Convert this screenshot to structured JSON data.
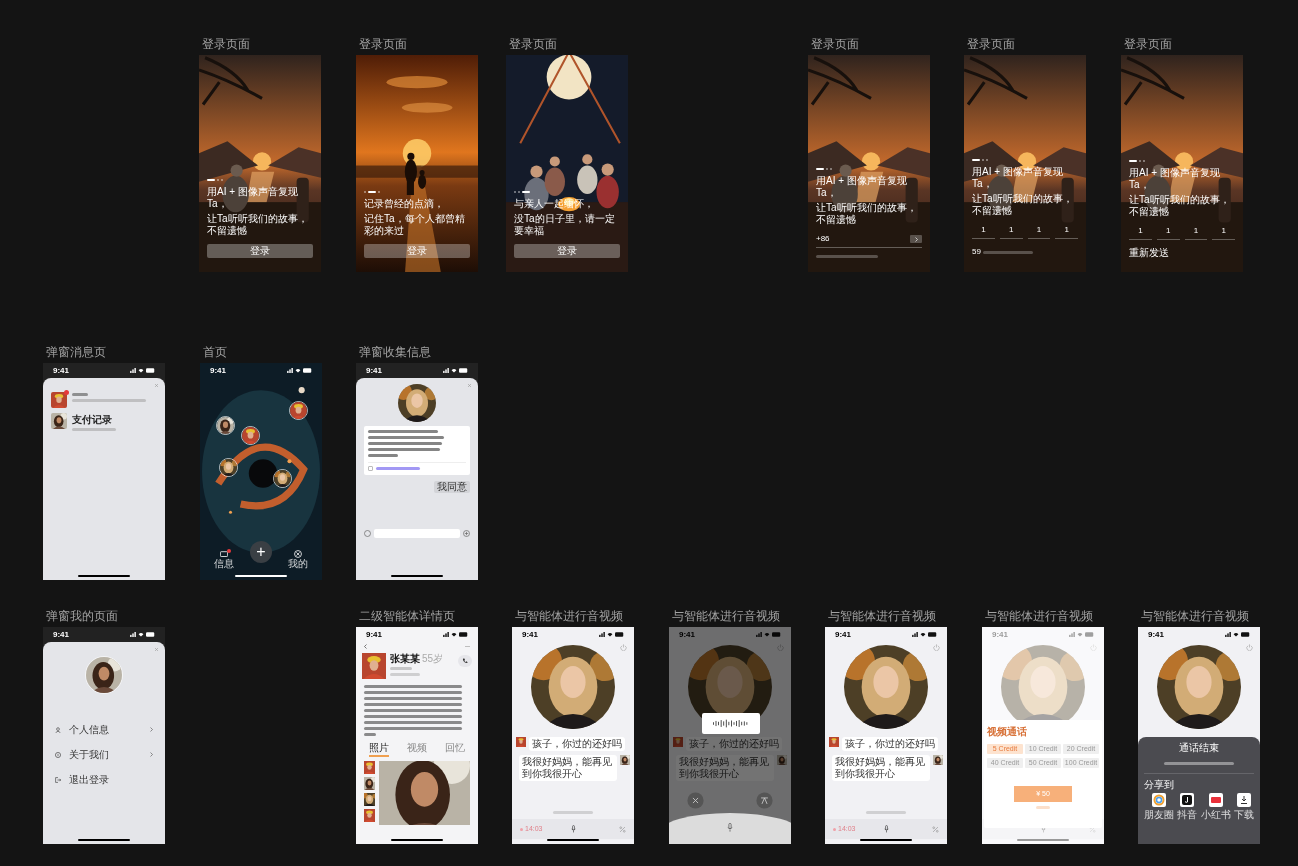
{
  "frames": [
    {
      "kind": "login",
      "label": "登录页面",
      "dots": [
        {
          "selected": true
        },
        {
          "selected": false
        },
        {
          "selected": false
        }
      ],
      "caption": [
        "用AI + 图像声音复现Ta，",
        "让Ta听听我们的故事，不留遗憾"
      ],
      "button": "登录"
    },
    {
      "kind": "login",
      "label": "登录页面",
      "dots": [
        {
          "selected": false
        },
        {
          "selected": true
        },
        {
          "selected": false
        }
      ],
      "caption": [
        "记录曾经的点滴，",
        "记住Ta，每个人都曾精彩的来过"
      ],
      "button": "登录"
    },
    {
      "kind": "login",
      "label": "登录页面",
      "dots": [
        {
          "selected": false
        },
        {
          "selected": false
        },
        {
          "selected": true
        }
      ],
      "caption": [
        "与亲人一起缅怀，",
        "没Ta的日子里，请一定要幸福"
      ],
      "button": "登录"
    },
    {
      "kind": "phone",
      "label": "登录页面",
      "dots": [
        {
          "selected": true
        },
        {
          "selected": false
        },
        {
          "selected": false
        }
      ],
      "caption": [
        "用AI + 图像声音复现Ta，",
        "让Ta听听我们的故事，不留遗憾"
      ],
      "prefix": "+86"
    },
    {
      "kind": "code",
      "label": "登录页面",
      "dots": [
        {
          "selected": true
        },
        {
          "selected": false
        },
        {
          "selected": false
        }
      ],
      "caption": [
        "用AI + 图像声音复现Ta，",
        "让Ta听听我们的故事，不留遗憾"
      ],
      "digits": [
        "1",
        "1",
        "1",
        "1"
      ],
      "countdown": "59"
    },
    {
      "kind": "code",
      "label": "登录页面",
      "dots": [
        {
          "selected": true
        },
        {
          "selected": false
        },
        {
          "selected": false
        }
      ],
      "caption": [
        "用AI + 图像声音复现Ta，",
        "让Ta听听我们的故事，不留遗憾"
      ],
      "digits": [
        "1",
        "1",
        "1",
        "1"
      ],
      "resend": "重新发送"
    },
    {
      "kind": "messages",
      "label": "弹窗消息页",
      "time": "9:41",
      "items": [
        {
          "badge": true
        },
        {
          "title": "支付记录",
          "badge": false
        }
      ]
    },
    {
      "kind": "home",
      "label": "首页",
      "time": "9:41",
      "add": "+",
      "tabs": [
        {
          "label": "信息",
          "badge": true
        },
        {
          "label": "我的",
          "badge": false
        }
      ]
    },
    {
      "kind": "collect",
      "label": "弹窗收集信息",
      "time": "9:41",
      "agree": "我同意",
      "consent_checked": false
    },
    {
      "kind": "mine",
      "label": "弹窗我的页面",
      "time": "9:41",
      "menu": [
        {
          "label": "个人信息",
          "arrow": true
        },
        {
          "label": "关于我们",
          "arrow": true
        },
        {
          "label": "退出登录",
          "arrow": false
        }
      ]
    },
    {
      "kind": "detail",
      "label": "二级智能体详情页",
      "time": "9:41",
      "name": "张某某",
      "age": "55岁",
      "tabs": [
        {
          "label": "照片",
          "selected": true
        },
        {
          "label": "视频",
          "selected": false
        },
        {
          "label": "回忆",
          "selected": false
        }
      ]
    },
    {
      "kind": "call",
      "label": "与智能体进行音视频",
      "time": "9:41",
      "messages": [
        "孩子，你过的还好吗",
        "我很好妈妈，能再见到你我很开心"
      ],
      "timer": "14:03"
    },
    {
      "kind": "call-voice",
      "label": "与智能体进行音视频",
      "time": "9:41",
      "messages": [
        "孩子，你过的还好吗",
        "我很好妈妈，能再见到你我很开心"
      ]
    },
    {
      "kind": "call",
      "label": "与智能体进行音视频",
      "time": "9:41",
      "messages": [
        "孩子，你过的还好吗",
        "我很好妈妈，能再见到你我很开心"
      ],
      "timer": "14:03"
    },
    {
      "kind": "call-pay",
      "label": "与智能体进行音视频",
      "time": "9:41",
      "dialog": {
        "title": "视频通话",
        "options": [
          {
            "label": "5 Credit",
            "selected": true
          },
          {
            "label": "10 Credit",
            "selected": false
          },
          {
            "label": "20 Credit",
            "selected": false
          },
          {
            "label": "40 Credit",
            "selected": false
          },
          {
            "label": "50 Credit",
            "selected": false
          },
          {
            "label": "100 Credit",
            "selected": false
          }
        ],
        "price": "¥ 50"
      }
    },
    {
      "kind": "call-end",
      "label": "与智能体进行音视频",
      "time": "9:41",
      "sheet": {
        "title": "通话结束",
        "share_label": "分享到",
        "share": [
          "朋友圈",
          "抖音",
          "小红书",
          "下载"
        ]
      }
    }
  ]
}
